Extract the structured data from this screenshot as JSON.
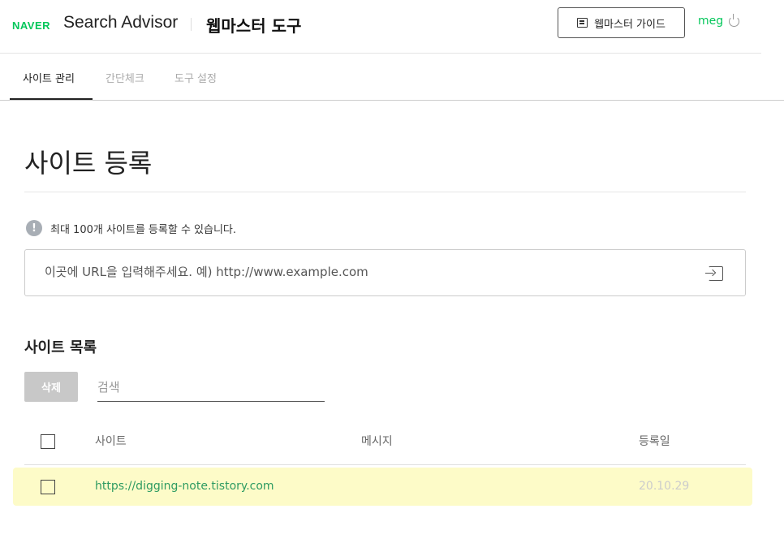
{
  "header": {
    "brand": "NAVER",
    "product": "Search Advisor",
    "title": "웹마스터 도구",
    "guide_button": "웹마스터 가이드",
    "user": "meg"
  },
  "tabs": [
    {
      "label": "사이트 관리",
      "active": true
    },
    {
      "label": "간단체크",
      "active": false
    },
    {
      "label": "도구 설정",
      "active": false
    }
  ],
  "main": {
    "page_title": "사이트 등록",
    "notice": "최대 100개 사이트를 등록할 수 있습니다.",
    "notice_icon": "!",
    "url_placeholder": "이곳에 URL을 입력해주세요. 예) http://www.example.com",
    "list_title": "사이트 목록",
    "delete_button": "삭제",
    "search_placeholder": "검색",
    "columns": [
      "사이트",
      "메시지",
      "등록일"
    ],
    "rows": [
      {
        "site": "https://digging-note.tistory.com",
        "message": "",
        "date": "20.10.29",
        "highlighted": true
      }
    ]
  },
  "colors": {
    "naver_green": "#03c75a",
    "link_green": "#2e9b62",
    "row_highlight": "#fdfbc8"
  }
}
